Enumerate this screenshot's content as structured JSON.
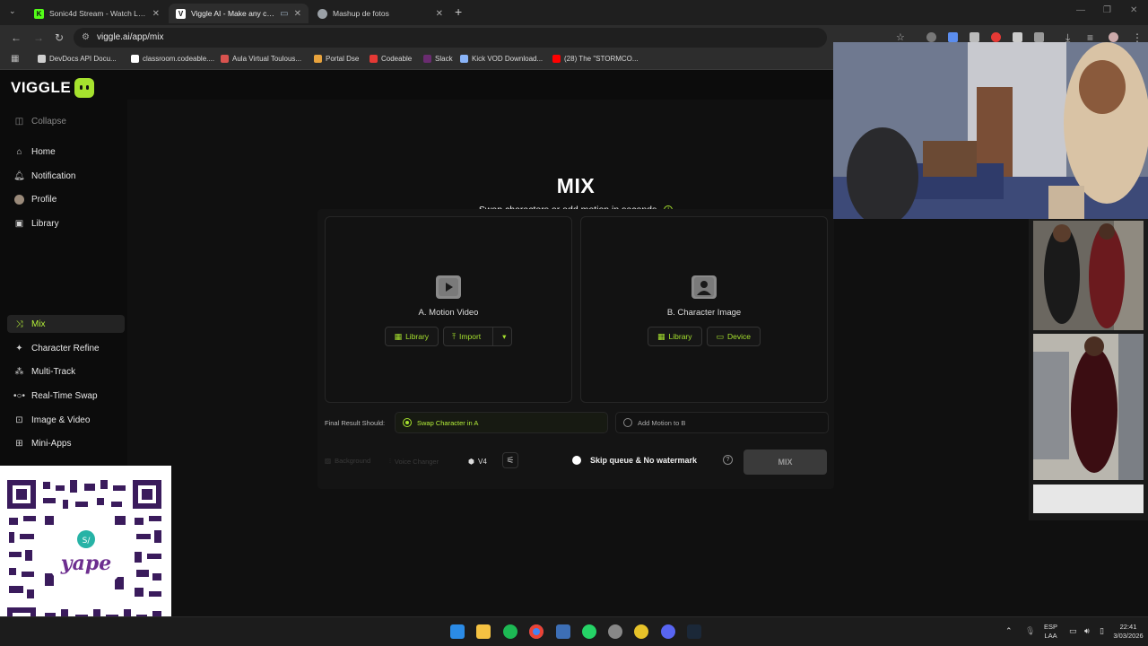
{
  "browser": {
    "tabs": [
      {
        "title": "Sonic4d Stream - Watch Live o",
        "favicon_color": "#53fc18",
        "glyph": "K"
      },
      {
        "title": "Viggle AI - Make any chara",
        "favicon_color": "#ffffff",
        "glyph": "V"
      },
      {
        "title": "Mashup de fotos",
        "favicon_color": "#9aa0a6",
        "glyph": ""
      }
    ],
    "url": "viggle.ai/app/mix",
    "bookmarks": [
      {
        "label": "DevDocs API Docu...",
        "color": "#cfcfcf"
      },
      {
        "label": "classroom.codeable....",
        "color": "#ffffff"
      },
      {
        "label": "Aula Virtual Toulous...",
        "color": "#d9534f"
      },
      {
        "label": "Portal Dse",
        "color": "#e8a33d"
      },
      {
        "label": "Codeable",
        "color": "#e53935"
      },
      {
        "label": "Slack",
        "color": "#4a154b"
      },
      {
        "label": "Kick VOD Download...",
        "color": "#8ab4f8"
      },
      {
        "label": "(28) The \"STORMCO...",
        "color": "#ff0000"
      }
    ]
  },
  "app": {
    "logo": "VIGGLE",
    "accent": "#a6e22e",
    "sidebar": {
      "collapse": "Collapse",
      "top_items": [
        "Home",
        "Notification",
        "Profile",
        "Library"
      ],
      "tool_items": [
        "Mix",
        "Character Refine",
        "Multi-Track",
        "Real-Time Swap",
        "Image & Video",
        "Mini-Apps"
      ]
    },
    "mix": {
      "title": "MIX",
      "subtitle": "Swap characters or add motion in seconds.",
      "card_a": {
        "label": "A. Motion Video",
        "btn_library": "Library",
        "btn_import": "Import"
      },
      "card_b": {
        "label": "B. Character Image",
        "btn_library": "Library",
        "btn_device": "Device"
      },
      "final_result_label": "Final Result Should:",
      "option_swap": "Swap Character in A",
      "option_motion": "Add Motion to B",
      "background": "Background",
      "voice_changer": "Voice Changer",
      "model": "V4",
      "skip_queue": "Skip queue & No watermark",
      "mix_button": "MIX"
    }
  },
  "taskbar": {
    "lang": "ESP",
    "layout": "LAA",
    "time": "22:41",
    "date": "3/03/2026"
  }
}
